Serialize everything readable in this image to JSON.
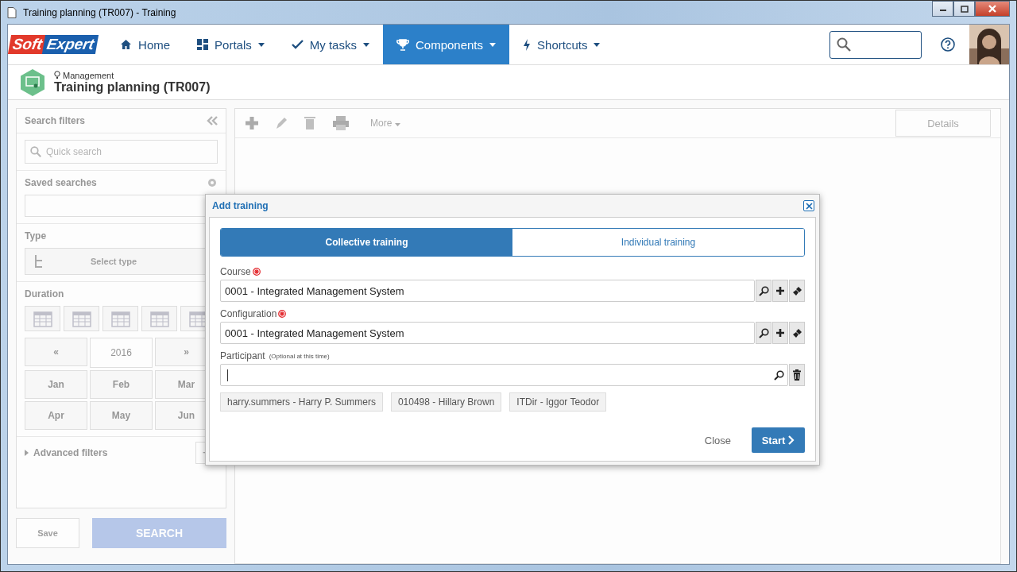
{
  "window": {
    "title": "Training planning (TR007) - Training"
  },
  "logo": {
    "part1": "Soft",
    "part2": "Expert"
  },
  "nav": {
    "items": [
      {
        "label": "Home",
        "selected": false,
        "caret": false
      },
      {
        "label": "Portals",
        "selected": false,
        "caret": true
      },
      {
        "label": "My tasks",
        "selected": false,
        "caret": true
      },
      {
        "label": "Components",
        "selected": true,
        "caret": true
      },
      {
        "label": "Shortcuts",
        "selected": false,
        "caret": true
      }
    ]
  },
  "header": {
    "breadcrumb": "Management",
    "title": "Training planning (TR007)"
  },
  "filters": {
    "title": "Search filters",
    "quick_search_placeholder": "Quick search",
    "saved_searches": "Saved searches",
    "type": "Type",
    "type_button": "Select type",
    "duration": "Duration",
    "year": "2016",
    "prev": "«",
    "next": "»",
    "months": [
      "Jan",
      "Feb",
      "Mar",
      "Apr",
      "May",
      "Jun"
    ],
    "advanced": "Advanced filters",
    "save": "Save",
    "search": "SEARCH"
  },
  "toolbar": {
    "more": "More",
    "details": "Details"
  },
  "dialog": {
    "title": "Add training",
    "tabs": [
      {
        "label": "Collective training",
        "selected": true
      },
      {
        "label": "Individual training",
        "selected": false
      }
    ],
    "fields": [
      {
        "kind": "lookup",
        "label": "Course",
        "required": true,
        "value": "0001 - Integrated Management System"
      },
      {
        "kind": "lookup",
        "label": "Configuration",
        "required": true,
        "value": "0001 - Integrated Management System"
      },
      {
        "kind": "multi",
        "label": "Participant",
        "hint": "(Optional at this time)",
        "required": false
      }
    ],
    "participants": [
      "harry.summers - Harry P. Summers",
      "010498 - Hillary Brown",
      "ITDir - Iggor Teodor"
    ],
    "close": "Close",
    "start": "Start"
  }
}
